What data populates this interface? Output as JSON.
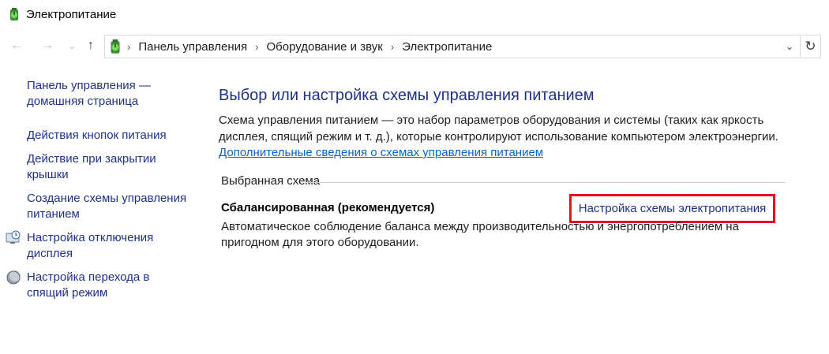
{
  "window": {
    "title": "Электропитание",
    "icon": "power-options-icon"
  },
  "navigation": {
    "back_icon": "arrow-left-icon",
    "forward_icon": "arrow-right-icon",
    "recent_icon": "chevron-down-icon",
    "up_icon": "arrow-up-icon",
    "breadcrumb": [
      "Панель управления",
      "Оборудование и звук",
      "Электропитание"
    ],
    "refresh_icon": "refresh-icon"
  },
  "sidebar": {
    "items": [
      {
        "label_line1": "Панель управления —",
        "label_line2": "домашняя страница"
      },
      {
        "label_line1": "Действия кнопок питания",
        "label_line2": ""
      },
      {
        "label_line1": "Действие при закрытии",
        "label_line2": "крышки"
      },
      {
        "label_line1": "Создание схемы управления",
        "label_line2": "питанием"
      },
      {
        "label_line1": "Настройка отключения",
        "label_line2": "дисплея",
        "icon": "display-clock-icon"
      },
      {
        "label_line1": "Настройка перехода в",
        "label_line2": "спящий режим",
        "icon": "moon-icon"
      }
    ]
  },
  "main": {
    "title": "Выбор или настройка схемы управления питанием",
    "description_line1": "Схема управления питанием — это набор параметров оборудования и системы (таких как яркость",
    "description_line2": "дисплея, спящий режим и т. д.), которые контролируют использование компьютером электроэнергии.",
    "more_link": "Дополнительные сведения о схемах управления питанием",
    "section_label": "Выбранная схема",
    "plan": {
      "name": "Сбалансированная (рекомендуется)",
      "settings_link": "Настройка схемы электропитания",
      "description_line1": "Автоматическое соблюдение баланса между производительностью и энергопотреблением на",
      "description_line2": "пригодном для этого оборудовании."
    }
  },
  "colors": {
    "link": "#1e3287",
    "hyperlink": "#0066cc",
    "highlight_border": "#e8101a"
  }
}
